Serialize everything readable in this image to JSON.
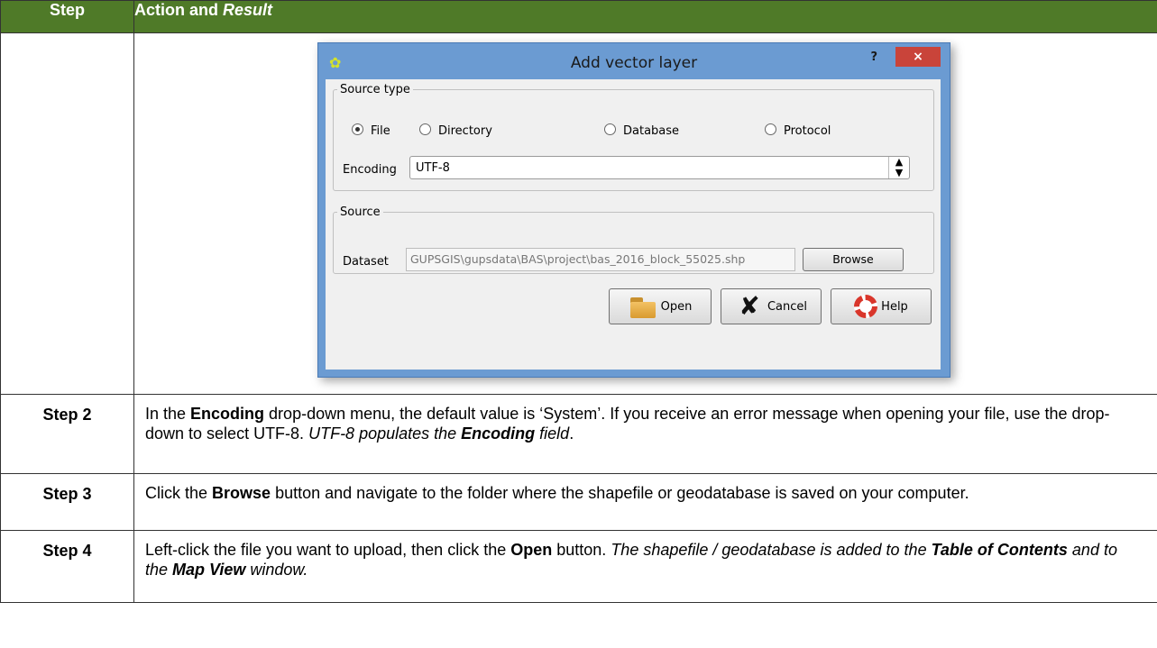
{
  "header": {
    "step": "Step",
    "action_prefix": "Action and ",
    "action_italic": "Result"
  },
  "dialog": {
    "title": "Add vector layer",
    "help_symbol": "?",
    "close_symbol": "×",
    "source_type_legend": "Source type",
    "radios": [
      "File",
      "Directory",
      "Database",
      "Protocol"
    ],
    "selected_radio": "File",
    "encoding_label": "Encoding",
    "encoding_value": "UTF-8",
    "source_legend": "Source",
    "dataset_label": "Dataset",
    "dataset_value": "GUPSGIS\\gupsdata\\BAS\\project\\bas_2016_block_55025.shp",
    "browse_label": "Browse",
    "open_label": "Open",
    "cancel_label": "Cancel",
    "help_label": "Help"
  },
  "rows": [
    {
      "step": "Step 2",
      "t1": "In the ",
      "b1": "Encoding",
      "t2": " drop-down menu, the default value is ‘System’. If you receive an error message when opening your file, use the drop-down to select UTF-8. ",
      "i1": "UTF-8 populates the ",
      "bi1": "Encoding",
      "i2": " field",
      "t3": "."
    },
    {
      "step": "Step 3",
      "t1": "Click the ",
      "b1": "Browse",
      "t2": " button and navigate to the folder where the shapefile or geodatabase is saved on your computer."
    },
    {
      "step": "Step 4",
      "t1": "Left-click the file you want to upload, then click the ",
      "b1": "Open",
      "t2": " button. ",
      "i1": "The shapefile / geodatabase is added to the ",
      "bi1": "Table of Contents",
      "i2": " and to the ",
      "bi2": "Map View",
      "i3": " window."
    }
  ],
  "colors": {
    "header_bg": "#4f7a28",
    "dialog_frame": "#6b9bd2",
    "close_button": "#c9443a"
  }
}
